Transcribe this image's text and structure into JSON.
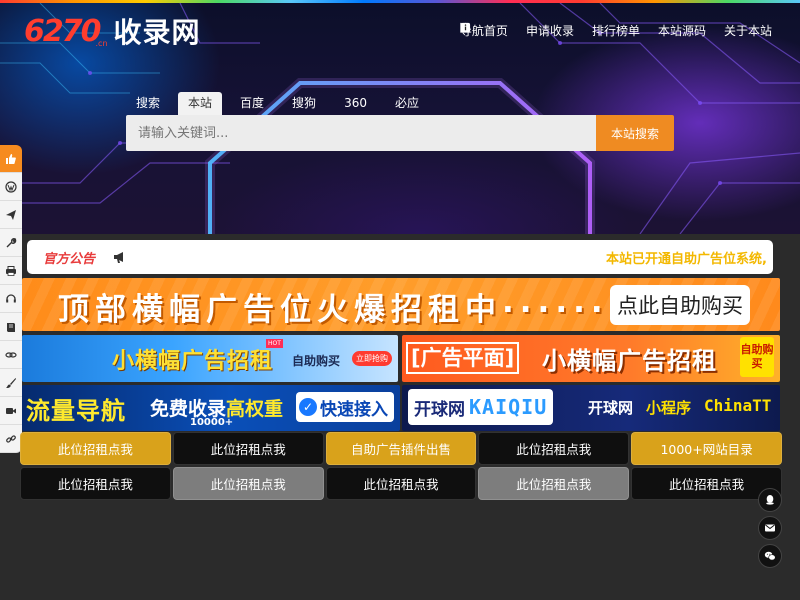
{
  "logo": {
    "number": "6270",
    "domain": ".cn",
    "text": "收录网"
  },
  "topnav": [
    {
      "label": "导航首页",
      "icon": "home-icon"
    },
    {
      "label": "申请收录",
      "icon": "plus-square-icon"
    },
    {
      "label": "排行榜单",
      "icon": "chart-icon"
    },
    {
      "label": "本站源码",
      "icon": "book-icon"
    },
    {
      "label": "关于本站",
      "icon": "info-icon"
    }
  ],
  "search": {
    "tabs": [
      "搜索",
      "本站",
      "百度",
      "搜狗",
      "360",
      "必应"
    ],
    "active_tab": "本站",
    "placeholder": "请输入关键词...",
    "button": "本站搜索"
  },
  "sidebar_icons": [
    "thumbs-up-icon",
    "wordpress-icon",
    "paper-plane-icon",
    "wrench-icon",
    "printer-icon",
    "headset-icon",
    "book-icon",
    "link-icon",
    "brush-icon",
    "video-icon",
    "chain-icon"
  ],
  "notice": {
    "label": "官方公告",
    "text": "本站已开通自助广告位系统,"
  },
  "ads": {
    "top_banner": {
      "text": "顶部横幅广告位火爆招租中······",
      "button": "点此自助购买"
    },
    "ad1": {
      "title": "小横幅广告招租",
      "hot": "HOT",
      "sub": "自助购买",
      "btn": "立即抢购"
    },
    "ad2": {
      "tag": "[广告平面]",
      "title": "小横幅广告招租",
      "btn": "自助购买"
    },
    "ad3": {
      "title": "流量导航",
      "t2a": "免费收录",
      "t2b": "高权重",
      "count": "10000+",
      "btn": "快速接入"
    },
    "ad4": {
      "logo_cn": "开球网",
      "logo_en": "KAIQIU",
      "name": "开球网",
      "mini": "小程序",
      "brand": "ChinaTT"
    }
  },
  "grid": [
    {
      "label": "此位招租点我",
      "style": "gold"
    },
    {
      "label": "此位招租点我",
      "style": "black"
    },
    {
      "label": "自助广告插件出售",
      "style": "gold"
    },
    {
      "label": "此位招租点我",
      "style": "black"
    },
    {
      "label": "1000+网站目录",
      "style": "gold"
    },
    {
      "label": "此位招租点我",
      "style": "black"
    },
    {
      "label": "此位招租点我",
      "style": "gray"
    },
    {
      "label": "此位招租点我",
      "style": "black"
    },
    {
      "label": "此位招租点我",
      "style": "gray"
    },
    {
      "label": "此位招租点我",
      "style": "black"
    }
  ],
  "float_icons": [
    "qq-icon",
    "mail-icon",
    "wechat-icon"
  ],
  "colors": {
    "accent": "#ef8b22",
    "gold": "#d9a21b",
    "notice": "#f3b800"
  }
}
